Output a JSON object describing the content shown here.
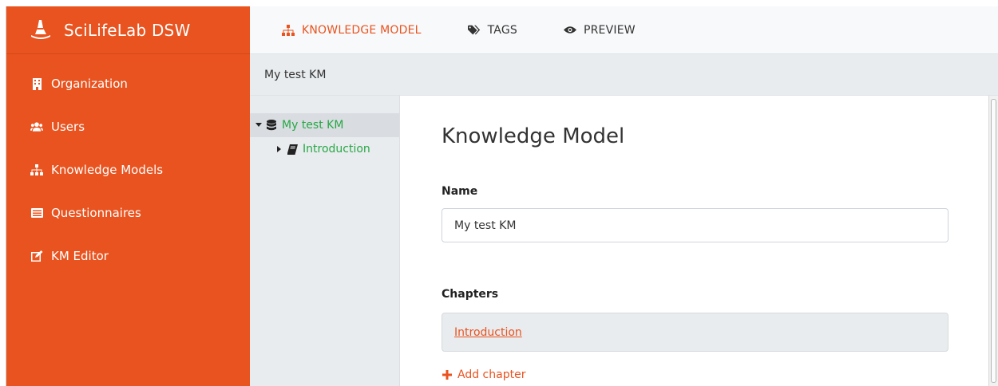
{
  "brand": {
    "name": "SciLifeLab DSW",
    "accent_color": "#e9531f"
  },
  "sidebar": {
    "items": [
      {
        "label": "Organization",
        "icon": "building-icon"
      },
      {
        "label": "Users",
        "icon": "users-icon"
      },
      {
        "label": "Knowledge Models",
        "icon": "sitemap-icon"
      },
      {
        "label": "Questionnaires",
        "icon": "list-alt-icon"
      },
      {
        "label": "KM Editor",
        "icon": "edit-icon"
      }
    ]
  },
  "topnav": {
    "tabs": [
      {
        "label": "KNOWLEDGE MODEL",
        "icon": "sitemap-icon",
        "active": true
      },
      {
        "label": "TAGS",
        "icon": "tags-icon",
        "active": false
      },
      {
        "label": "PREVIEW",
        "icon": "eye-icon",
        "active": false
      }
    ]
  },
  "breadcrumb": {
    "title": "My test KM"
  },
  "tree": {
    "root": {
      "label": "My test KM",
      "icon": "database-icon",
      "expanded": true
    },
    "children": [
      {
        "label": "Introduction",
        "icon": "book-icon",
        "expanded": false
      }
    ],
    "link_color": "#28a745"
  },
  "main": {
    "title": "Knowledge Model",
    "name_label": "Name",
    "name_value": "My test KM",
    "chapters_label": "Chapters",
    "chapters": [
      "Introduction"
    ],
    "add_chapter_label": "Add chapter"
  }
}
